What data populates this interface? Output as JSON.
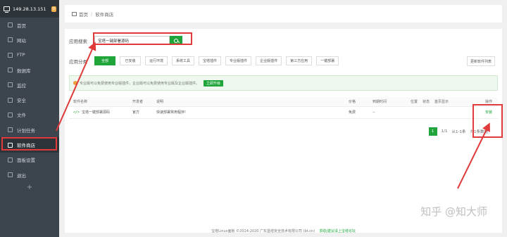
{
  "sidebar": {
    "server_ip": "149.28.13.151",
    "badge": "0",
    "items": [
      {
        "label": "首页",
        "icon": "home-icon"
      },
      {
        "label": "网站",
        "icon": "globe-icon"
      },
      {
        "label": "FTP",
        "icon": "ftp-icon"
      },
      {
        "label": "数据库",
        "icon": "database-icon"
      },
      {
        "label": "监控",
        "icon": "monitor-icon"
      },
      {
        "label": "安全",
        "icon": "shield-icon"
      },
      {
        "label": "文件",
        "icon": "folder-icon"
      },
      {
        "label": "计划任务",
        "icon": "clock-icon"
      },
      {
        "label": "软件商店",
        "icon": "grid-icon"
      },
      {
        "label": "面板设置",
        "icon": "settings-icon"
      },
      {
        "label": "退出",
        "icon": "logout-icon"
      }
    ],
    "add": "+"
  },
  "breadcrumb": {
    "home": "首页",
    "sep": "/",
    "current": "软件商店"
  },
  "search": {
    "label": "应用搜索",
    "value": "宝塔一键部署源码"
  },
  "categories": {
    "label": "应用分类",
    "items": [
      "全部",
      "已安装",
      "运行环境",
      "系统工具",
      "宝塔插件",
      "专业版插件",
      "企业版插件",
      "第三方应用",
      "一键部署"
    ],
    "refresh": "更新软件列表"
  },
  "notice": {
    "text": "专业版可以免费使用专业版插件，企业版可以免费使用专业版及企业版插件。",
    "button": "立即升级"
  },
  "table": {
    "headers": [
      "软件名称",
      "开发者",
      "说明",
      "价格",
      "到期时间",
      "位置",
      "状态",
      "首页显示",
      "操作"
    ],
    "row": {
      "name": "宝塔一键部署源码",
      "dev": "官方",
      "desc": "快速部署常用程序!",
      "price": "免费",
      "expire": "--",
      "action": "安装"
    }
  },
  "pager": {
    "page": "1",
    "of": "1/1",
    "range": "从1-1条",
    "total": "共1条数据"
  },
  "footer": {
    "copyright": "宝塔Linux面板 ©2014-2020 广东堡塔安全技术有限公司 (bt.cn)",
    "link": "求助|建议请上宝塔论坛"
  },
  "watermark": "知乎 @知大师",
  "colors": {
    "accent": "#20a53a",
    "annotation": "#e03a3a",
    "sidebar": "#3c444d"
  }
}
